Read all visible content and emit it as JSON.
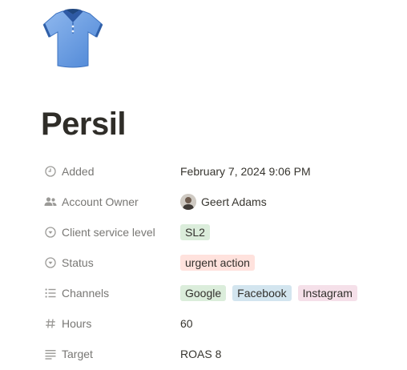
{
  "page": {
    "icon": "polo-shirt-icon",
    "title": "Persil"
  },
  "properties": [
    {
      "key": "added",
      "icon": "clock-icon",
      "label": "Added",
      "value": "February 7, 2024 9:06 PM"
    },
    {
      "key": "account_owner",
      "icon": "people-icon",
      "label": "Account Owner",
      "value": "Geert Adams"
    },
    {
      "key": "service_level",
      "icon": "select-icon",
      "label": "Client service level",
      "tags": [
        {
          "text": "SL2",
          "color": "#dbeddb"
        }
      ]
    },
    {
      "key": "status",
      "icon": "select-icon",
      "label": "Status",
      "tags": [
        {
          "text": "urgent action",
          "color": "#ffe2dd"
        }
      ]
    },
    {
      "key": "channels",
      "icon": "list-icon",
      "label": "Channels",
      "tags": [
        {
          "text": "Google",
          "color": "#dbeddb"
        },
        {
          "text": "Facebook",
          "color": "#d3e5ef"
        },
        {
          "text": "Instagram",
          "color": "#f5e0e9"
        }
      ]
    },
    {
      "key": "hours",
      "icon": "hash-icon",
      "label": "Hours",
      "value": "60"
    },
    {
      "key": "target",
      "icon": "text-lines-icon",
      "label": "Target",
      "value": "ROAS 8"
    }
  ]
}
